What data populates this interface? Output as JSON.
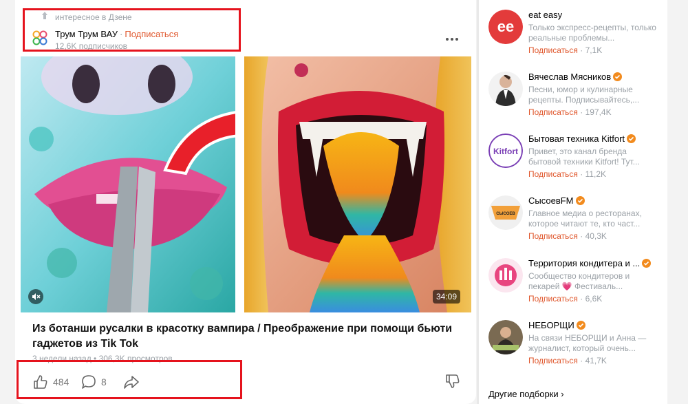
{
  "post": {
    "meta_label": "интересное в Дзене",
    "channel_name": "Трум Трум ВАУ",
    "separator": "·",
    "subscribe_label": "Подписаться",
    "subscribers": "12,6K подписчиков",
    "duration": "34:09",
    "title": "Из ботанши русалки в красотку вампира / Преображение при помощи бьюти гаджетов из Tik Tok",
    "stats": "3 недели назад • 306,3K просмотров",
    "likes": "484",
    "comments": "8"
  },
  "sidebar": {
    "items": [
      {
        "name": "eat easy",
        "desc": "Только экспресс-рецепты, только реальные проблемы...",
        "subscribe": "Подписаться",
        "count": "· 7,1K",
        "verified": false
      },
      {
        "name": "Вячеслав Мясников",
        "desc": "Песни, юмор и кулинарные рецепты. Подписывайтесь,...",
        "subscribe": "Подписаться",
        "count": "· 197,4K",
        "verified": true
      },
      {
        "name": "Бытовая техника Kitfort",
        "desc": "Привет, это канал бренда бытовой техники Kitfort! Тут...",
        "subscribe": "Подписаться",
        "count": "· 11,2K",
        "verified": true
      },
      {
        "name": "СысоевFM",
        "desc": "Главное медиа о ресторанах, которое читают те, кто част...",
        "subscribe": "Подписаться",
        "count": "· 40,3K",
        "verified": true
      },
      {
        "name": "Территория кондитера и ...",
        "desc": "Сообщество кондитеров и пекарей 💗 Фестиваль...",
        "subscribe": "Подписаться",
        "count": "· 6,6K",
        "verified": true
      },
      {
        "name": "НЕБОРЩИ",
        "desc": "На связи НЕБОРЩИ и Анна — журналист, который очень...",
        "subscribe": "Подписаться",
        "count": "· 41,7K",
        "verified": true
      }
    ],
    "logo_text": {
      "eat_easy": "ee",
      "kitfort": "Kitfort",
      "sysoev": "СЫСОЕВ"
    },
    "more_label": "Другие подборки",
    "more_chevron": "›"
  },
  "colors": {
    "accent": "#e0582e",
    "highlight": "#e5131d",
    "verified": "#f28b1e"
  },
  "icons": [
    "pin-icon",
    "channel-logo-icon",
    "more-dots-icon",
    "mute-icon",
    "like-icon",
    "comment-icon",
    "share-icon",
    "dislike-icon",
    "verified-icon",
    "chevron-right-icon"
  ]
}
